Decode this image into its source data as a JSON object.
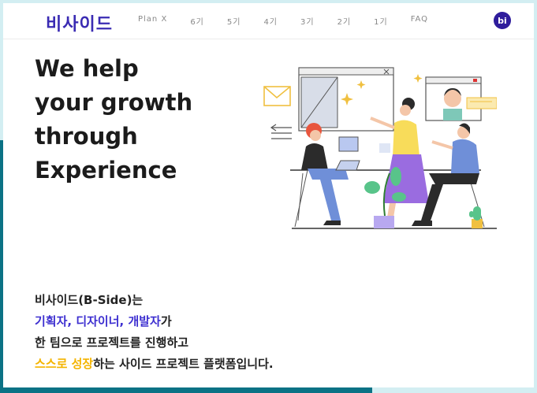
{
  "header": {
    "logo": "비사이드",
    "nav": [
      "Plan X",
      "6기",
      "5기",
      "4기",
      "3기",
      "2기",
      "1기",
      "FAQ"
    ],
    "avatar": "bi"
  },
  "hero": {
    "headline": [
      "We help",
      "your growth",
      "through",
      "Experience"
    ]
  },
  "description": {
    "line1": "비사이드(B-Side)는",
    "line2_highlight": "기획자, 디자이너, 개발자",
    "line2_suffix": "가",
    "line3": "한 팀으로 프로젝트를 진행하고",
    "line4_highlight": "스스로 성장",
    "line4_suffix": "하는 사이드 프로젝트 플랫폼입니다."
  },
  "colors": {
    "brand": "#3a2bb3",
    "highlight_blue": "#3d2fd0",
    "highlight_yellow": "#f4b400",
    "frame_teal": "#0b7285"
  }
}
